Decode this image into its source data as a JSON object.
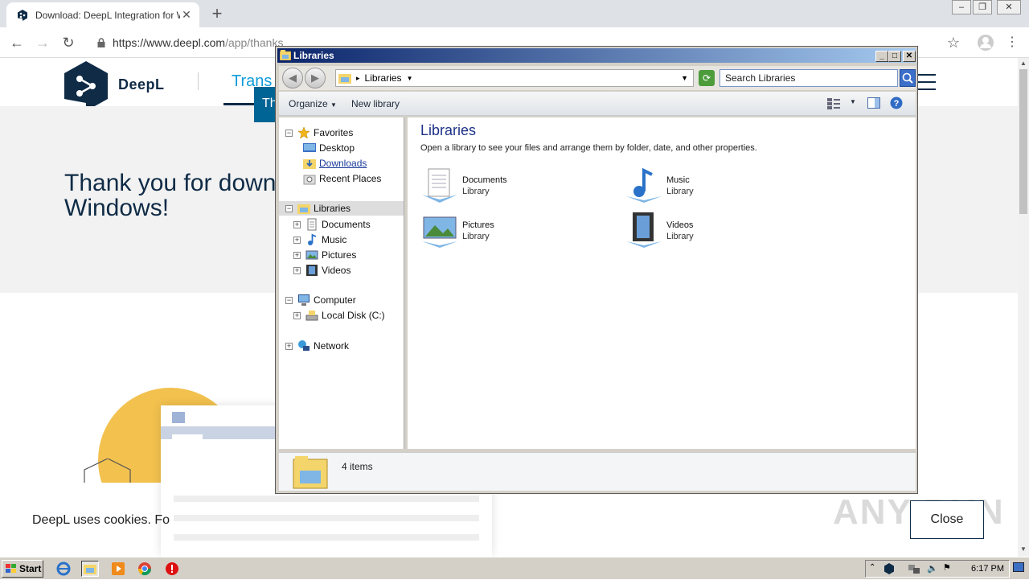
{
  "browser": {
    "tab_title": "Download: DeepL Integration for Wi",
    "url_main": "https://www.deepl.com",
    "url_path": "/app/thanks"
  },
  "page": {
    "logo_text": "DeepL",
    "nav_translator": "Trans",
    "tooltip_text": "Th",
    "thanks_line1": "Thank you for downl",
    "thanks_line2": "Windows!",
    "cookies_text": "DeepL uses cookies. Fo",
    "close_label": "Close",
    "watermark": "ANY RUN"
  },
  "explorer": {
    "title": "Libraries",
    "address_crumb": "Libraries",
    "search_placeholder": "Search Libraries",
    "commands": {
      "organize": "Organize",
      "new_library": "New library"
    },
    "nav": {
      "favorites": "Favorites",
      "desktop": "Desktop",
      "downloads": "Downloads",
      "recent": "Recent Places",
      "libraries": "Libraries",
      "documents": "Documents",
      "music": "Music",
      "pictures": "Pictures",
      "videos": "Videos",
      "computer": "Computer",
      "local_disk": "Local Disk (C:)",
      "network": "Network"
    },
    "heading": "Libraries",
    "subheading": "Open a library to see your files and arrange them by folder, date, and other properties.",
    "libraries": [
      {
        "name": "Documents",
        "type": "Library"
      },
      {
        "name": "Music",
        "type": "Library"
      },
      {
        "name": "Pictures",
        "type": "Library"
      },
      {
        "name": "Videos",
        "type": "Library"
      }
    ],
    "item_count": "4 items"
  },
  "taskbar": {
    "start_label": "Start",
    "clock": "6:17 PM"
  },
  "colors": {
    "deepl_navy": "#0f2b46",
    "deepl_blue": "#0f9cd9",
    "title_bar": "#0a246a"
  }
}
